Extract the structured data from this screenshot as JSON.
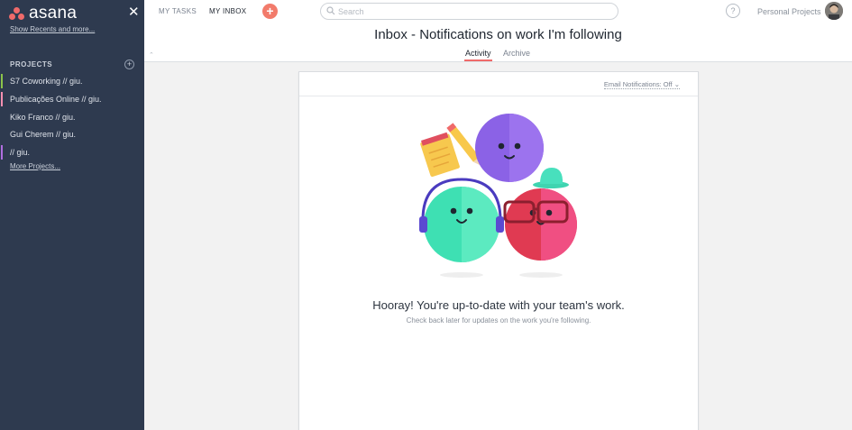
{
  "app": {
    "logo_text": "asana",
    "brand_color": "#f06a6a",
    "sidebar_color": "#2e3a4f"
  },
  "sidebar": {
    "close_icon": "close-icon",
    "show_recents": "Show Recents and more...",
    "projects_label": "PROJECTS",
    "projects": [
      {
        "label": "S7 Coworking // giu.",
        "color": "#8bc34a"
      },
      {
        "label": "Publicações Online // giu.",
        "color": "#f48fb1"
      },
      {
        "label": "Kiko Franco // giu.",
        "color": ""
      },
      {
        "label": "Gui Cherem // giu.",
        "color": ""
      },
      {
        "label": "// giu.",
        "color": "#b06ee0"
      }
    ],
    "more_projects": "More Projects..."
  },
  "topbar": {
    "my_tasks": "MY TASKS",
    "my_inbox": "MY INBOX",
    "add_icon": "plus-icon",
    "search_placeholder": "Search",
    "help": "?",
    "workspace": "Personal Projects"
  },
  "header": {
    "title": "Inbox - Notifications on work I'm following",
    "tabs": [
      "Activity",
      "Archive"
    ],
    "active_tab": "Activity"
  },
  "card": {
    "email_notifications": "Email Notifications: Off",
    "hooray": "Hooray! You're up-to-date with your team's work.",
    "checkback": "Check back later for updates on the work you're following."
  }
}
